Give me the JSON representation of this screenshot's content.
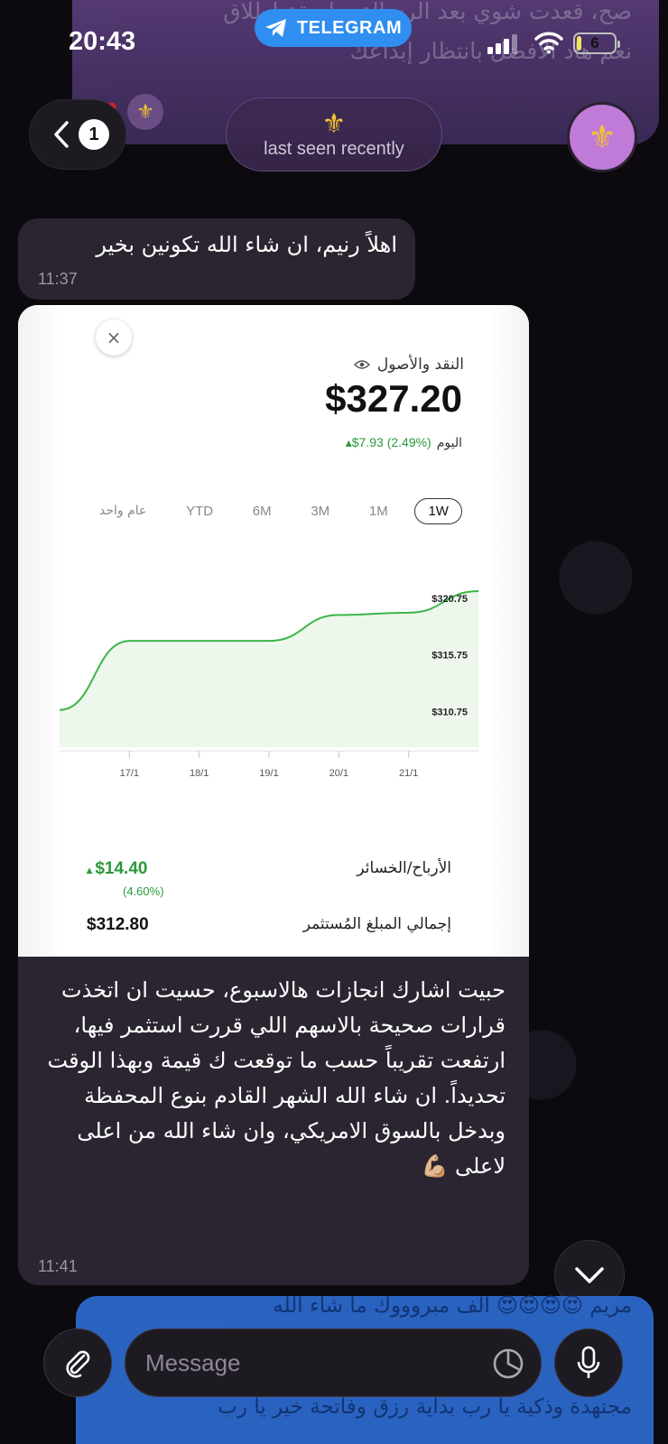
{
  "status_bar": {
    "time": "20:43",
    "source_app": "TELEGRAM",
    "battery": "6",
    "battery_level": 0.12
  },
  "background_preview": {
    "line1": "صح، قعدت شوي بعد الرسالة بطريقة اطلاق",
    "line2": "نعم هاد الافضل بانتظار إبداعك"
  },
  "header": {
    "back_badge": "1",
    "contact_glyph": "⚜",
    "status_text": "last seen recently",
    "avatar_glyph": "⚜"
  },
  "messages": [
    {
      "text": "اهلاً رنيم، ان شاء الله تكونين بخير",
      "time": "11:37"
    },
    {
      "text": "حبيت اشارك انجازات هالاسبوع، حسيت ان اتخذت قرارات صحيحة بالاسهم اللي قررت استثمر فيها، ارتفعت تقريباً حسب ما توقعت ك قيمة وبهذا الوقت تحديداً. ان شاء الله الشهر القادم بنوع المحفظة وبدخل بالسوق الامريكي، وان شاء الله من اعلى لاعلى 💪🏼",
      "time": "11:41"
    }
  ],
  "portfolio": {
    "close_glyph": "×",
    "label": "النقد والأصول",
    "value": "$327.20",
    "day_change": "$7.93 (2.49%)",
    "day_label": "اليوم",
    "ranges": [
      "1W",
      "1M",
      "3M",
      "6M",
      "YTD",
      "عام واحد"
    ],
    "active_range": "1W",
    "pnl_label": "الأرباح/الخسائر",
    "pnl_value": "$14.40",
    "pnl_percent": "(4.60%)",
    "invested_label": "إجمالي المبلغ المُستثمر",
    "invested_value": "$312.80"
  },
  "chart_data": {
    "type": "line",
    "x": [
      "16/1",
      "17/1",
      "18/1",
      "19/1",
      "20/1",
      "21/1",
      "22/1"
    ],
    "x_ticks": [
      "17/1",
      "18/1",
      "19/1",
      "20/1",
      "21/1"
    ],
    "y": [
      310.8,
      316.9,
      316.9,
      316.9,
      319.2,
      319.4,
      321.3
    ],
    "y_ticks": [
      "$320.75",
      "$315.75",
      "$310.75"
    ],
    "ylim": [
      307.5,
      322.5
    ],
    "line_color": "#3cb54a",
    "fill_color": "#eef7ec",
    "grid": false
  },
  "outgoing_preview": {
    "line1": "مريم 😍😍😍😍 الف مبروووك ما شاء الله",
    "line2": "مجتهدة وذكية يا رب بداية رزق وفاتحة خير يا رب"
  },
  "composer": {
    "placeholder": "Message"
  },
  "colors": {
    "accent": "#2f8ef0",
    "bubble": "#2a2530",
    "outgoing": "#2f6fd9"
  }
}
